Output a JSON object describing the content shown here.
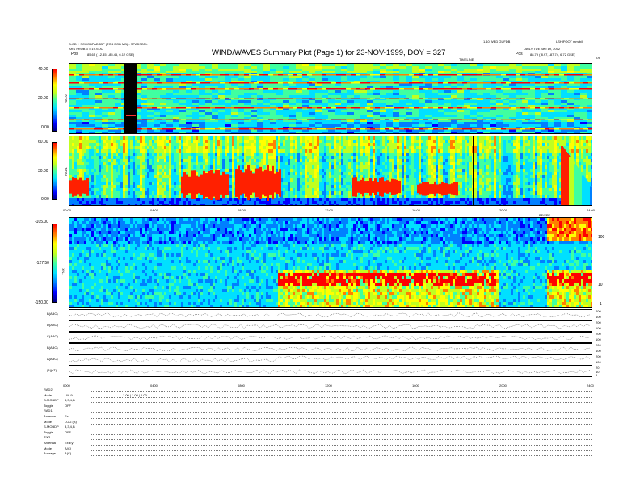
{
  "header": {
    "title": "WIND/WAVES Summary Plot (Page 1) for 23-NOV-1999, DOY = 327",
    "left_line1": "S-CD + SCOOBPADSBP (TOB BOB MB) - SPADSBPL",
    "left_line2": "ARS FROB 3 = 19.SOC",
    "left_line3_label": "Pos",
    "left_line3_value": "85.65 ( 12.45, -85.45, 6.12 GSE)",
    "right_line1": "1.10 WED GUFDB",
    "right_line2": "LSHIFOOT mm/b/l",
    "right_line3": "DAILY TUE Sep 19, 2002",
    "right_line4_label": "Pos",
    "right_line4_value": "88.79 ( 8.97, -87.74, 6.72 GSE)",
    "time_label_top": "TIMELINE",
    "time_label_right": "T/B"
  },
  "rad2": {
    "label": "RAD2",
    "ticks": [
      "40.00",
      "20.00",
      "0.00"
    ]
  },
  "rad1": {
    "label": "RAD1",
    "ticks": [
      "60.00",
      "30.00",
      "0.00"
    ]
  },
  "tnr": {
    "label": "TNR",
    "ticks": [
      "-105.00",
      "-127.50",
      "-150.00"
    ],
    "right_ticks": [
      "100",
      "10",
      "1"
    ],
    "annotation": "BF/SPE"
  },
  "time_axis": {
    "ticks": [
      "00:00",
      "04:00",
      "08:00",
      "12:00",
      "16:00",
      "20:00",
      "24:00"
    ]
  },
  "time_axis_bottom": {
    "ticks": [
      "0000",
      "0400",
      "0800",
      "1200",
      "1600",
      "2000",
      "2400"
    ]
  },
  "line_panels": [
    {
      "label": "B(ABC)",
      "ticks": [
        "200",
        "100"
      ]
    },
    {
      "label": "D(ABC)",
      "ticks": [
        "200",
        "100"
      ]
    },
    {
      "label": "C(ABC)",
      "ticks": [
        "200",
        "100"
      ]
    },
    {
      "label": "B(ABC)",
      "ticks": [
        "200",
        "100"
      ]
    },
    {
      "label": "A(ABC)",
      "ticks": [
        "200",
        "100"
      ]
    },
    {
      "label": "|B|(nT)",
      "ticks": [
        "20",
        "10",
        "0"
      ]
    }
  ],
  "info_rows": [
    {
      "k": "RAD2",
      "v": ""
    },
    {
      "k": "Mode",
      "v": "LIN 9",
      "extra": "1.00 | 1.00 | 1.00"
    },
    {
      "k": "S-MOBDP",
      "v": "3,3,4,B"
    },
    {
      "k": "Toggle",
      "v": "OFF"
    },
    {
      "k": "RAD1",
      "v": ""
    },
    {
      "k": "Antenna",
      "v": "Ex"
    },
    {
      "k": "Mode",
      "v": "LOG (B)"
    },
    {
      "k": "S-MOBDP",
      "v": "3,3,4,B"
    },
    {
      "k": "Toggle",
      "v": "OFF"
    },
    {
      "k": "TNR",
      "v": ""
    },
    {
      "k": "Antenna",
      "v": "Ex,Ey"
    },
    {
      "k": "Mode",
      "v": "A(C)"
    },
    {
      "k": "Average",
      "v": "A(C)"
    }
  ],
  "colors": {
    "spectrum": [
      "#000080",
      "#0000ff",
      "#0080ff",
      "#00e0ff",
      "#40ffa0",
      "#c0ff20",
      "#ffff00",
      "#ff8000",
      "#ff0000"
    ]
  }
}
